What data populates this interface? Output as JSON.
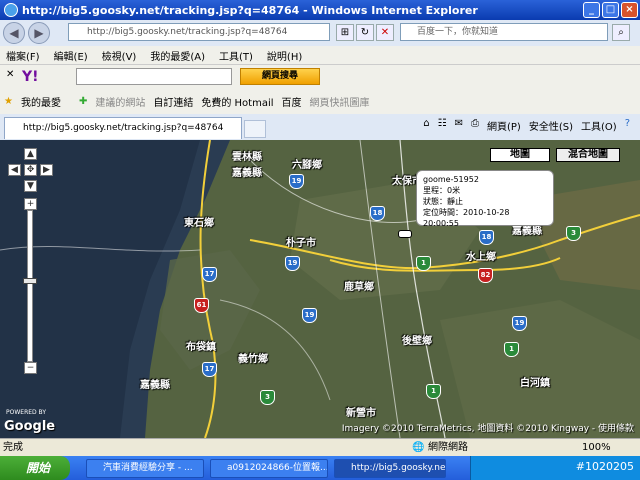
{
  "window": {
    "title": "http://big5.goosky.net/tracking.jsp?q=48764 - Windows Internet Explorer"
  },
  "address": {
    "url": "http://big5.goosky.net/tracking.jsp?q=48764"
  },
  "search": {
    "placeholder": "百度一下，你就知道"
  },
  "menu": [
    "檔案(F)",
    "編輯(E)",
    "檢視(V)",
    "我的最愛(A)",
    "工具(T)",
    "說明(H)"
  ],
  "yahoo": {
    "logo": "Y!",
    "search_button": "網頁搜尋"
  },
  "favorites": {
    "label": "我的最愛",
    "items": [
      "建議的網站",
      "自訂連結",
      "免費的 Hotmail",
      "百度",
      "網頁快訊圖庫"
    ]
  },
  "tab": {
    "title": "http://big5.goosky.net/tracking.jsp?q=48764"
  },
  "commandbar": {
    "page": "網頁(P)",
    "safety": "安全性(S)",
    "tools": "工具(O)"
  },
  "map": {
    "type_buttons": [
      "地圖",
      "混合地圖"
    ],
    "zoom_in": "+",
    "zoom_out": "−",
    "labels": [
      "雲林縣",
      "嘉義縣",
      "六腳鄉",
      "太保市",
      "東石鄉",
      "朴子市",
      "鹿草鄉",
      "水上鄉",
      "嘉義縣",
      "布袋鎮",
      "義竹鄉",
      "後壁鄉",
      "白河鎮",
      "新營市",
      "嘉義縣"
    ],
    "shields": [
      "19",
      "18",
      "1",
      "17",
      "19",
      "82",
      "61",
      "17",
      "19",
      "18",
      "1",
      "3",
      "19",
      "1",
      "3"
    ],
    "info": {
      "device": "goome-51952",
      "line1": "里程：0米",
      "line2": "狀態：靜止",
      "line3": "定位時間：2010-10-28 20:00:55"
    },
    "attribution": "Imagery ©2010 TerraMetrics, 地圖資料 ©2010 Kingway - 使用條款",
    "logo": "Google",
    "powered": "POWERED BY"
  },
  "status": {
    "text": "完成",
    "zone": "網際網路",
    "zoom": "100%"
  },
  "taskbar": {
    "start": "開始",
    "items": [
      "汽車消費經驗分享 - ...",
      "a0912024866-位置報...",
      "http://big5.goosky.net/..."
    ],
    "clock": "#1020205"
  }
}
